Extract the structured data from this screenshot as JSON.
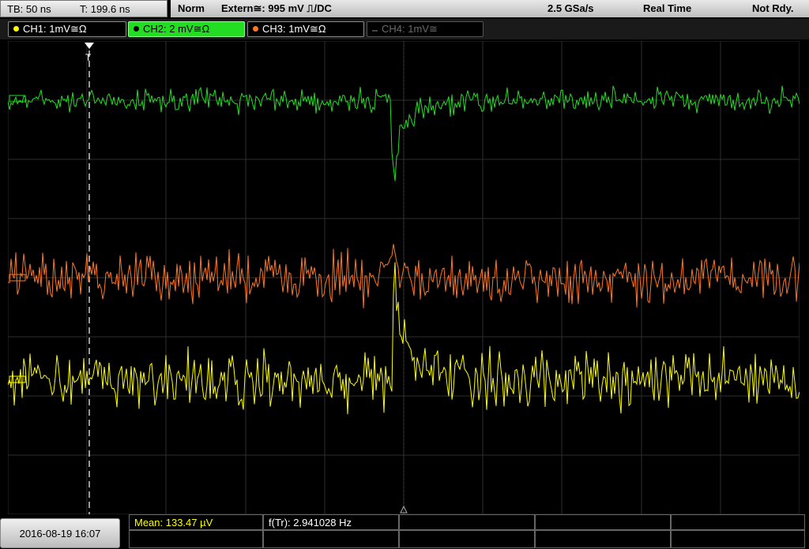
{
  "header": {
    "timebase": "TB: 50 ns",
    "trigger_time": "T: 199.6 ns",
    "mode": "Norm",
    "trigger_source": "Extern≅: 995 mV ⎍/DC",
    "sample_rate": "2.5 GSa/s",
    "acq_mode": "Real Time",
    "status": "Not Rdy."
  },
  "channels": [
    {
      "id": "ch1",
      "label": "CH1: 1mV≅Ω",
      "color": "#ffff00",
      "active": false,
      "enabled": true
    },
    {
      "id": "ch2",
      "label": "CH2: 2 mV≅Ω",
      "color": "#22dd22",
      "active": true,
      "enabled": true
    },
    {
      "id": "ch3",
      "label": "CH3: 1mV≅Ω",
      "color": "#ff7722",
      "active": false,
      "enabled": true
    },
    {
      "id": "ch4",
      "label": "CH4: 1mV≅",
      "color": "#666666",
      "active": false,
      "enabled": false
    }
  ],
  "measurements": {
    "mean_label": "Mean: 133.47 µV",
    "freq_label": "f(Tr): 2.941028 Hz"
  },
  "footer": {
    "datetime": "2016-08-19 16:07"
  },
  "colors": {
    "ch1_trace": "#ffff00",
    "ch2_trace": "#22dd22",
    "ch3_trace": "#ff7722",
    "grid": "#2e2e2e"
  },
  "icons": [
    "trigger-marker-icon",
    "trigger-position-icon",
    "channel-ref-icon"
  ]
}
